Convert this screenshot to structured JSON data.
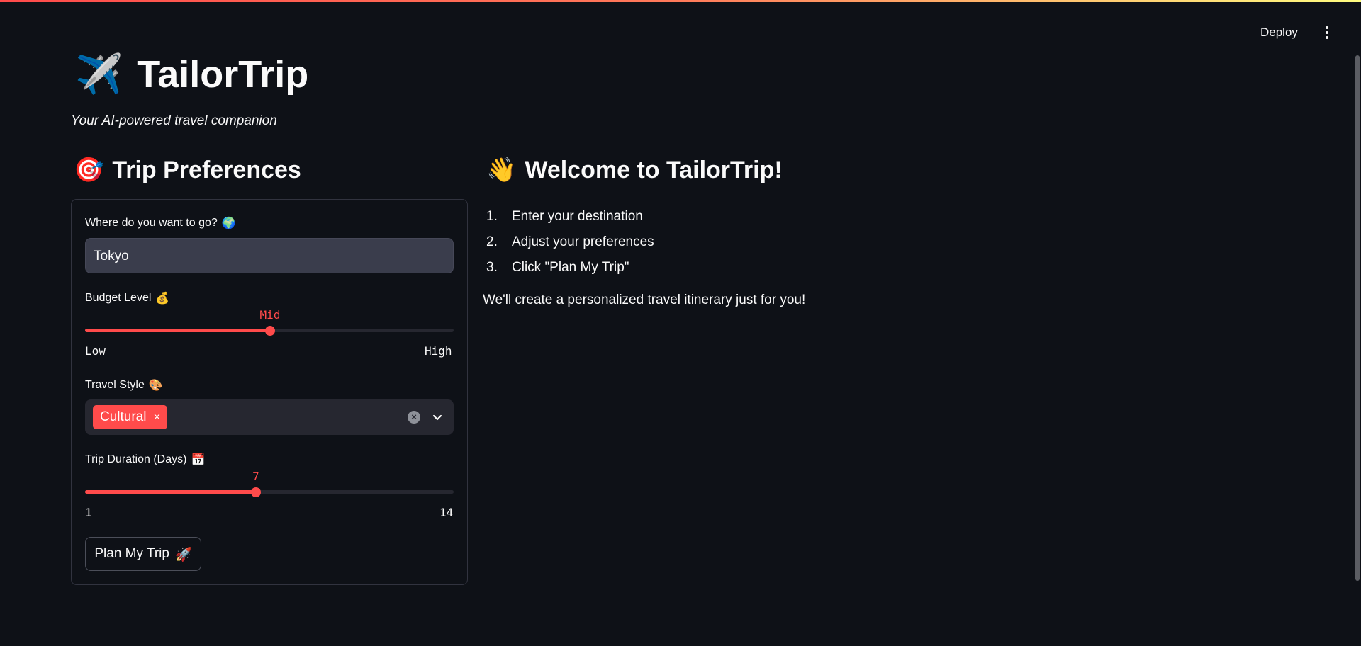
{
  "header": {
    "deploy_label": "Deploy",
    "menu_icon": "more-vertical-icon"
  },
  "app": {
    "title_icon": "✈️",
    "title": "TailorTrip",
    "subtitle": "Your AI-powered travel companion"
  },
  "preferences": {
    "heading_icon": "🎯",
    "heading": "Trip Preferences",
    "destination": {
      "label": "Where do you want to go?",
      "label_icon": "🌍",
      "value": "Tokyo"
    },
    "budget": {
      "label": "Budget Level",
      "label_icon": "💰",
      "value": "Mid",
      "min_label": "Low",
      "max_label": "High",
      "position_fraction": 0.5
    },
    "travel_style": {
      "label": "Travel Style",
      "label_icon": "🎨",
      "selected": [
        "Cultural"
      ],
      "remove_glyph": "×"
    },
    "duration": {
      "label": "Trip Duration (Days)",
      "label_icon": "📅",
      "value": "7",
      "min": "1",
      "max": "14"
    },
    "submit": {
      "label": "Plan My Trip",
      "icon": "🚀"
    }
  },
  "welcome": {
    "heading_icon": "👋",
    "heading": "Welcome to TailorTrip!",
    "steps": [
      {
        "num": "1.",
        "text": "Enter your destination"
      },
      {
        "num": "2.",
        "text": "Adjust your preferences"
      },
      {
        "num": "3.",
        "text": "Click \"Plan My Trip\""
      }
    ],
    "note": "We'll create a personalized travel itinerary just for you!"
  },
  "colors": {
    "background": "#0e1117",
    "accent": "#ff4b4b",
    "input_bg": "#262730",
    "text": "#fafafa"
  }
}
